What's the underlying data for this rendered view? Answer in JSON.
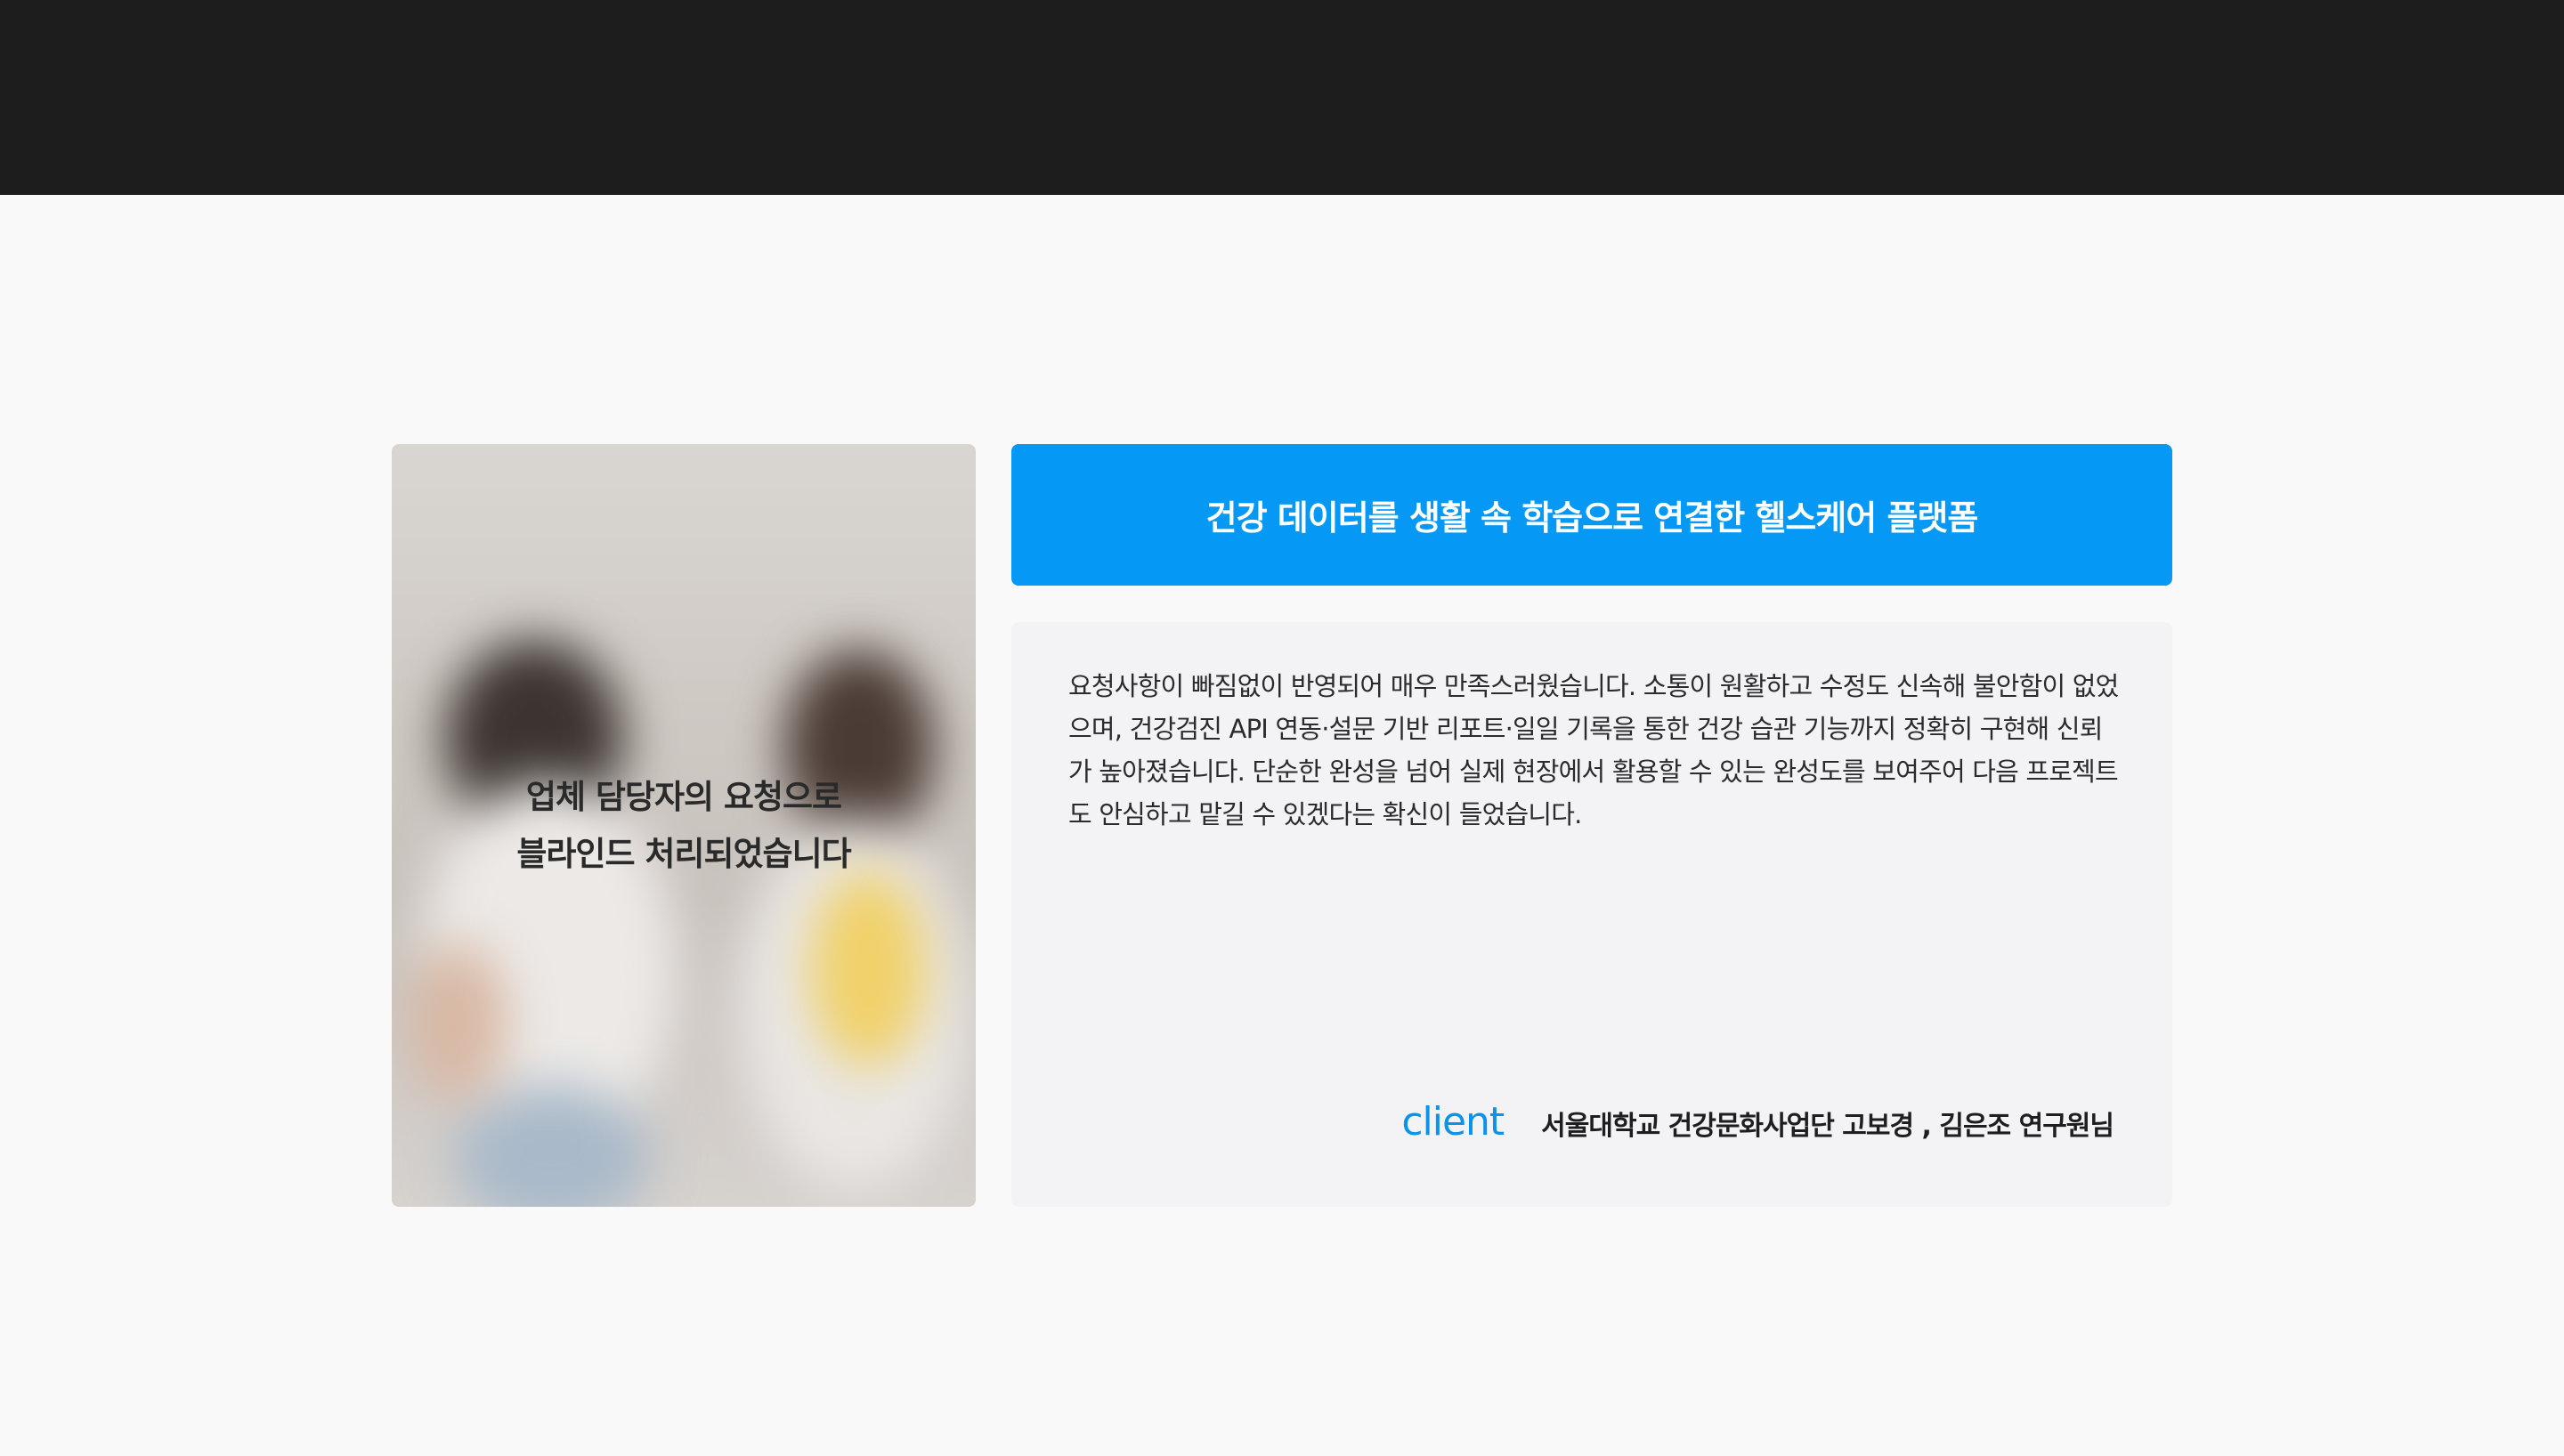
{
  "photo": {
    "caption_line1": "업체 담당자의 요청으로",
    "caption_line2": "블라인드 처리되었습니다"
  },
  "title": "건강 데이터를 생활 속 학습으로 연결한 헬스케어 플랫폼",
  "review": {
    "text": "요청사항이 빠짐없이 반영되어 매우 만족스러웠습니다. 소통이 원활하고 수정도 신속해 불안함이 없었으며, 건강검진 API 연동·설문 기반 리포트·일일 기록을 통한 건강 습관 기능까지 정확히 구현해 신뢰가 높아졌습니다. 단순한 완성을 넘어 실제 현장에서 활용할 수 있는 완성도를 보여주어 다음 프로젝트도 안심하고 맡길 수 있겠다는 확신이 들었습니다."
  },
  "client": {
    "label": "client",
    "name": "서울대학교 건강문화사업단 고보경 , 김은조 연구원님"
  },
  "colors": {
    "top_bar": "#1d1d1d",
    "accent": "#0599f5",
    "client_label": "#0a93e8",
    "page_bg": "#f9f9f9",
    "review_bg": "#f3f3f5"
  }
}
